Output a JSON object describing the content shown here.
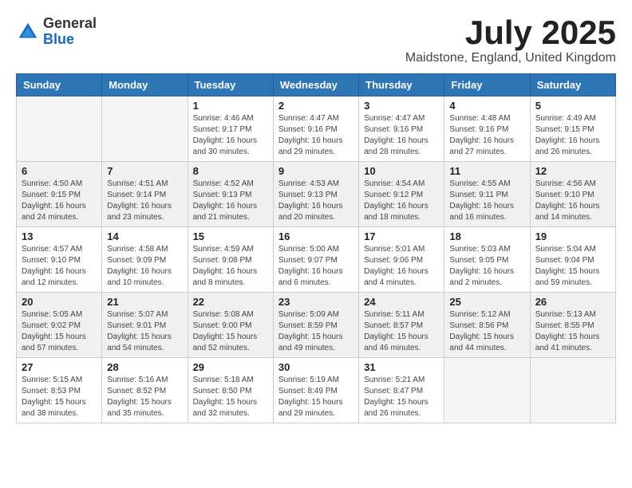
{
  "logo": {
    "general": "General",
    "blue": "Blue"
  },
  "title": "July 2025",
  "location": "Maidstone, England, United Kingdom",
  "weekdays": [
    "Sunday",
    "Monday",
    "Tuesday",
    "Wednesday",
    "Thursday",
    "Friday",
    "Saturday"
  ],
  "weeks": [
    [
      {
        "day": "",
        "info": ""
      },
      {
        "day": "",
        "info": ""
      },
      {
        "day": "1",
        "info": "Sunrise: 4:46 AM\nSunset: 9:17 PM\nDaylight: 16 hours and 30 minutes."
      },
      {
        "day": "2",
        "info": "Sunrise: 4:47 AM\nSunset: 9:16 PM\nDaylight: 16 hours and 29 minutes."
      },
      {
        "day": "3",
        "info": "Sunrise: 4:47 AM\nSunset: 9:16 PM\nDaylight: 16 hours and 28 minutes."
      },
      {
        "day": "4",
        "info": "Sunrise: 4:48 AM\nSunset: 9:16 PM\nDaylight: 16 hours and 27 minutes."
      },
      {
        "day": "5",
        "info": "Sunrise: 4:49 AM\nSunset: 9:15 PM\nDaylight: 16 hours and 26 minutes."
      }
    ],
    [
      {
        "day": "6",
        "info": "Sunrise: 4:50 AM\nSunset: 9:15 PM\nDaylight: 16 hours and 24 minutes."
      },
      {
        "day": "7",
        "info": "Sunrise: 4:51 AM\nSunset: 9:14 PM\nDaylight: 16 hours and 23 minutes."
      },
      {
        "day": "8",
        "info": "Sunrise: 4:52 AM\nSunset: 9:13 PM\nDaylight: 16 hours and 21 minutes."
      },
      {
        "day": "9",
        "info": "Sunrise: 4:53 AM\nSunset: 9:13 PM\nDaylight: 16 hours and 20 minutes."
      },
      {
        "day": "10",
        "info": "Sunrise: 4:54 AM\nSunset: 9:12 PM\nDaylight: 16 hours and 18 minutes."
      },
      {
        "day": "11",
        "info": "Sunrise: 4:55 AM\nSunset: 9:11 PM\nDaylight: 16 hours and 16 minutes."
      },
      {
        "day": "12",
        "info": "Sunrise: 4:56 AM\nSunset: 9:10 PM\nDaylight: 16 hours and 14 minutes."
      }
    ],
    [
      {
        "day": "13",
        "info": "Sunrise: 4:57 AM\nSunset: 9:10 PM\nDaylight: 16 hours and 12 minutes."
      },
      {
        "day": "14",
        "info": "Sunrise: 4:58 AM\nSunset: 9:09 PM\nDaylight: 16 hours and 10 minutes."
      },
      {
        "day": "15",
        "info": "Sunrise: 4:59 AM\nSunset: 9:08 PM\nDaylight: 16 hours and 8 minutes."
      },
      {
        "day": "16",
        "info": "Sunrise: 5:00 AM\nSunset: 9:07 PM\nDaylight: 16 hours and 6 minutes."
      },
      {
        "day": "17",
        "info": "Sunrise: 5:01 AM\nSunset: 9:06 PM\nDaylight: 16 hours and 4 minutes."
      },
      {
        "day": "18",
        "info": "Sunrise: 5:03 AM\nSunset: 9:05 PM\nDaylight: 16 hours and 2 minutes."
      },
      {
        "day": "19",
        "info": "Sunrise: 5:04 AM\nSunset: 9:04 PM\nDaylight: 15 hours and 59 minutes."
      }
    ],
    [
      {
        "day": "20",
        "info": "Sunrise: 5:05 AM\nSunset: 9:02 PM\nDaylight: 15 hours and 57 minutes."
      },
      {
        "day": "21",
        "info": "Sunrise: 5:07 AM\nSunset: 9:01 PM\nDaylight: 15 hours and 54 minutes."
      },
      {
        "day": "22",
        "info": "Sunrise: 5:08 AM\nSunset: 9:00 PM\nDaylight: 15 hours and 52 minutes."
      },
      {
        "day": "23",
        "info": "Sunrise: 5:09 AM\nSunset: 8:59 PM\nDaylight: 15 hours and 49 minutes."
      },
      {
        "day": "24",
        "info": "Sunrise: 5:11 AM\nSunset: 8:57 PM\nDaylight: 15 hours and 46 minutes."
      },
      {
        "day": "25",
        "info": "Sunrise: 5:12 AM\nSunset: 8:56 PM\nDaylight: 15 hours and 44 minutes."
      },
      {
        "day": "26",
        "info": "Sunrise: 5:13 AM\nSunset: 8:55 PM\nDaylight: 15 hours and 41 minutes."
      }
    ],
    [
      {
        "day": "27",
        "info": "Sunrise: 5:15 AM\nSunset: 8:53 PM\nDaylight: 15 hours and 38 minutes."
      },
      {
        "day": "28",
        "info": "Sunrise: 5:16 AM\nSunset: 8:52 PM\nDaylight: 15 hours and 35 minutes."
      },
      {
        "day": "29",
        "info": "Sunrise: 5:18 AM\nSunset: 8:50 PM\nDaylight: 15 hours and 32 minutes."
      },
      {
        "day": "30",
        "info": "Sunrise: 5:19 AM\nSunset: 8:49 PM\nDaylight: 15 hours and 29 minutes."
      },
      {
        "day": "31",
        "info": "Sunrise: 5:21 AM\nSunset: 8:47 PM\nDaylight: 15 hours and 26 minutes."
      },
      {
        "day": "",
        "info": ""
      },
      {
        "day": "",
        "info": ""
      }
    ]
  ]
}
